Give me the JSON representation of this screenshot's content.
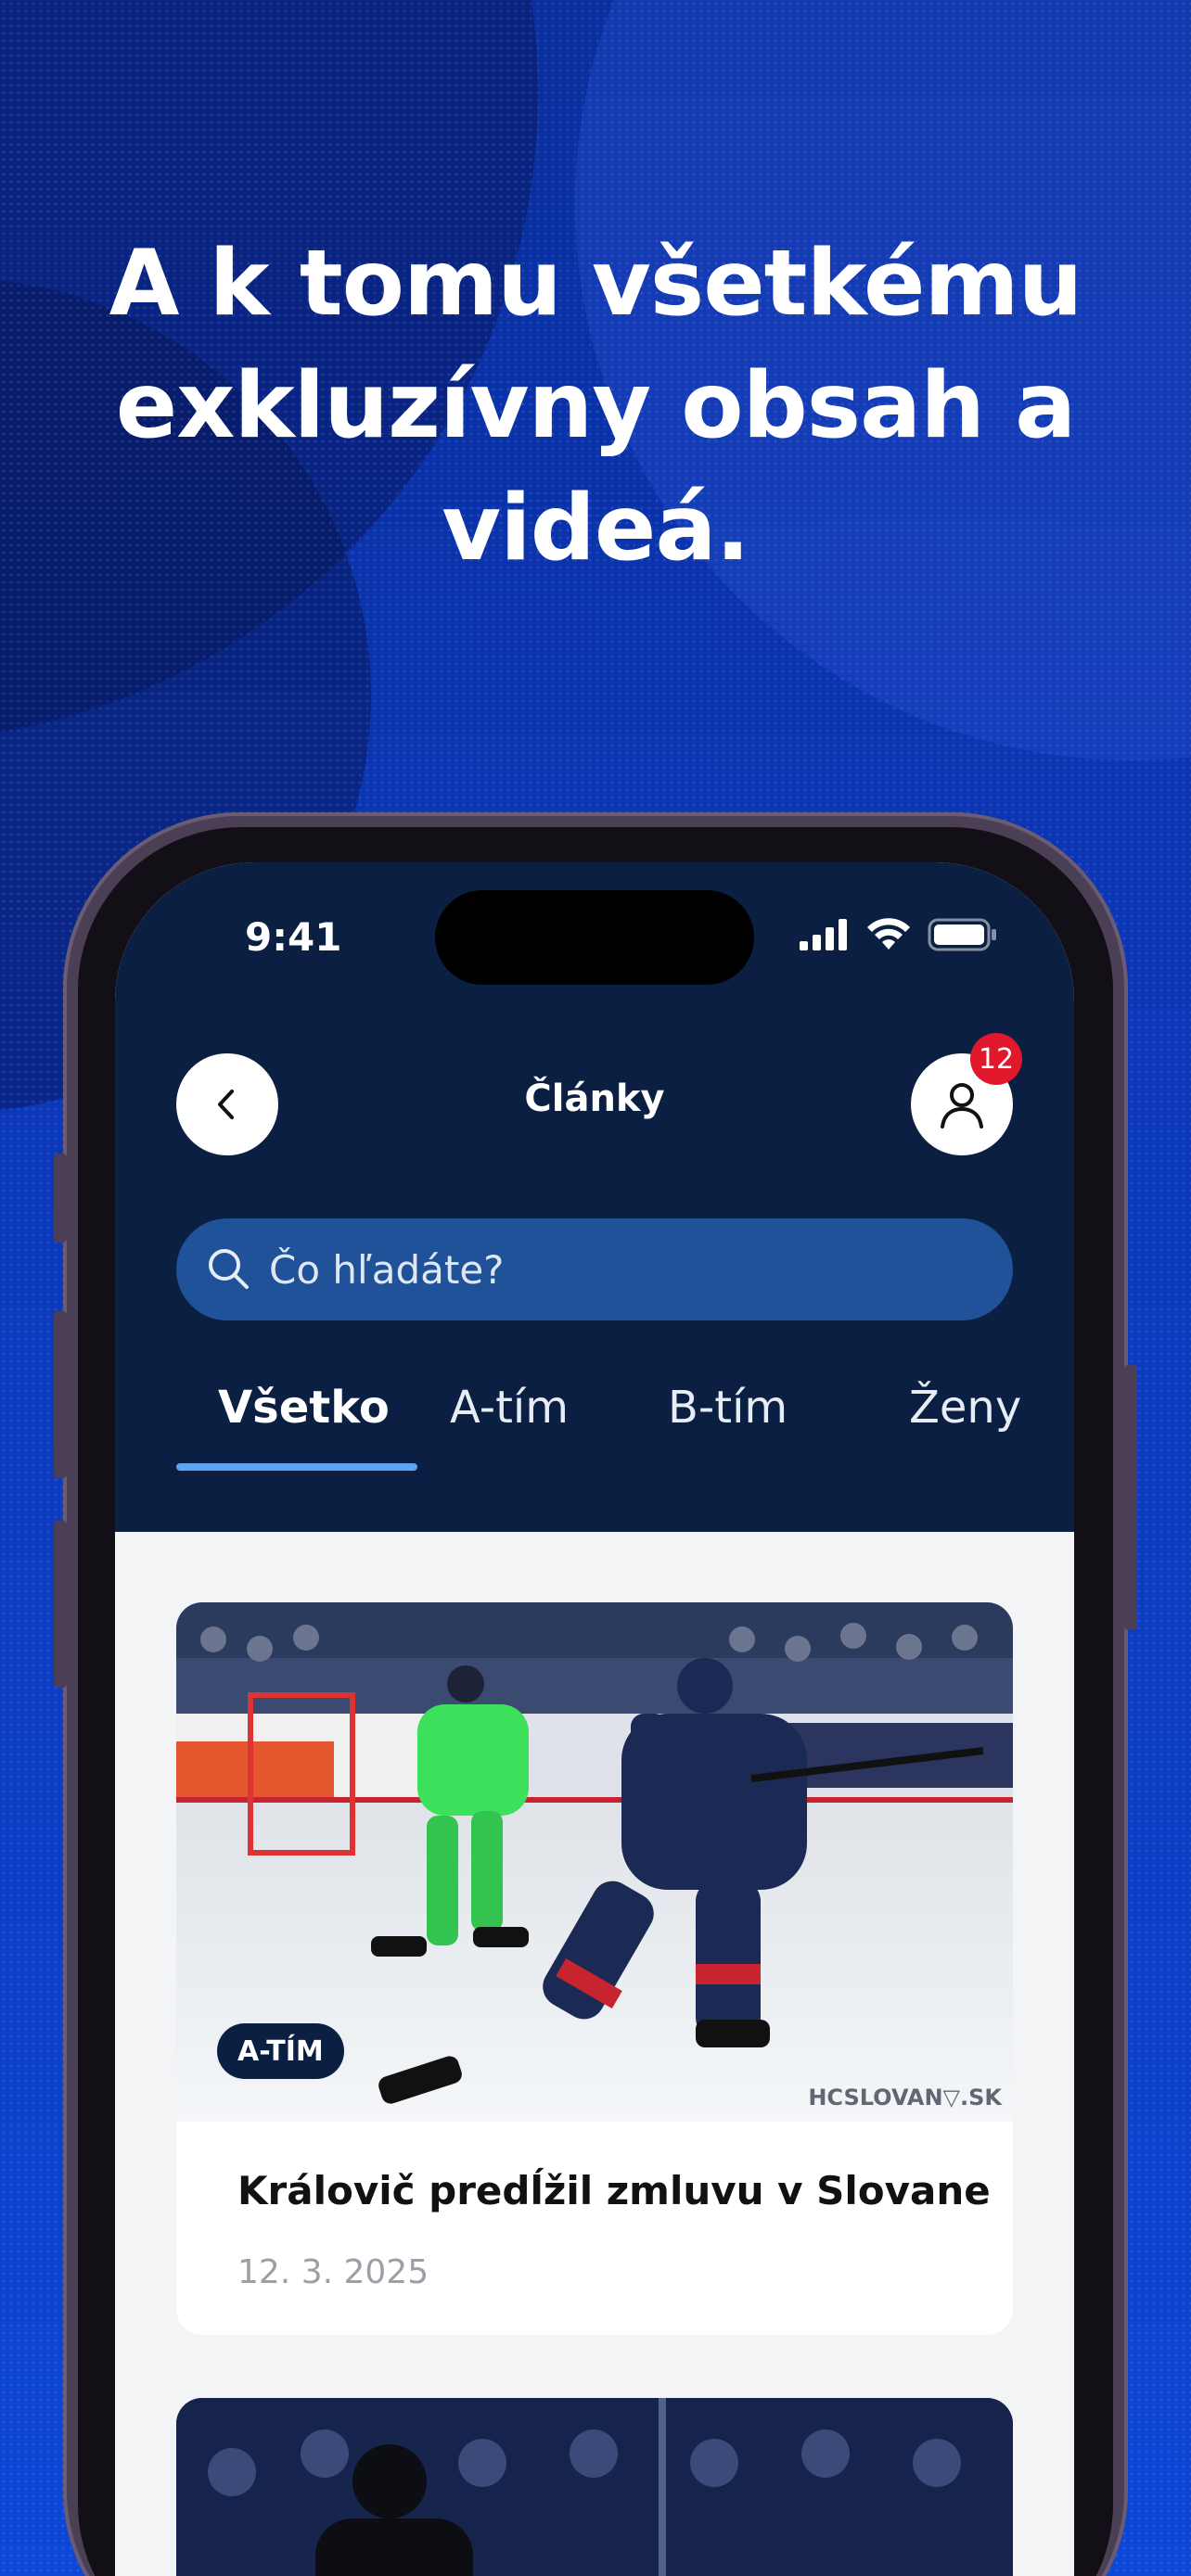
{
  "headline": "A k tomu všetkému\nexkluzívny obsah a\nvideá.",
  "status_bar": {
    "time": "9:41"
  },
  "header": {
    "title": "Články",
    "notification_count": "12"
  },
  "search": {
    "placeholder": "Čo hľadáte?"
  },
  "tabs": [
    {
      "label": "Všetko",
      "active": true
    },
    {
      "label": "A-tím",
      "active": false
    },
    {
      "label": "B-tím",
      "active": false
    },
    {
      "label": "Ženy",
      "active": false
    }
  ],
  "articles": [
    {
      "tag": "A-TÍM",
      "title": "Královič predĺžil zmluvu v Slovane",
      "date": "12. 3. 2025",
      "image_watermark": "HCSLOVAN▽.SK"
    }
  ],
  "colors": {
    "brand_navy": "#0b1f42",
    "search_fill": "#1f5298",
    "tab_indicator": "#5ea4f4",
    "badge_red": "#e1172b",
    "background_blue": "#0b37b8"
  },
  "icons": [
    "chevron-left-icon",
    "user-icon",
    "search-icon",
    "signal-icon",
    "wifi-icon",
    "battery-icon"
  ]
}
